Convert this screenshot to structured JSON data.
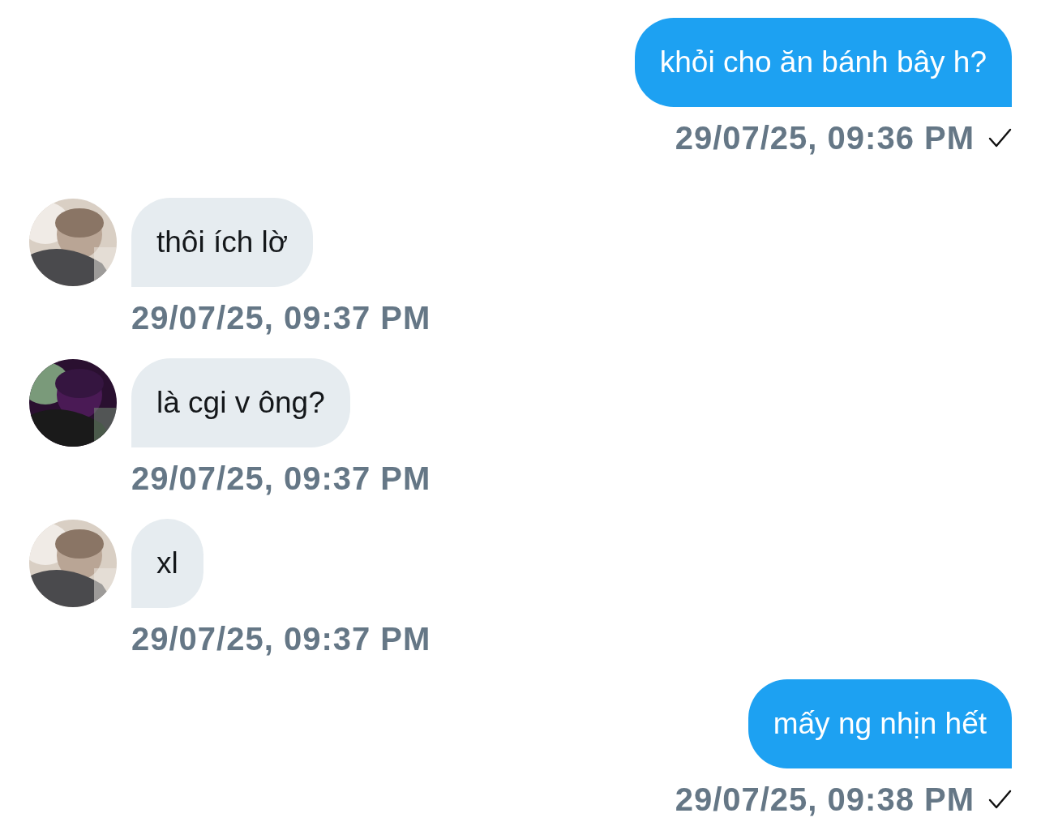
{
  "messages": [
    {
      "kind": "sent",
      "text": "khỏi cho ăn bánh bây h?",
      "time": "29/07/25, 09:36 PM",
      "delivered": true
    },
    {
      "kind": "received",
      "text": "thôi ích lờ",
      "time": "29/07/25, 09:37 PM"
    },
    {
      "kind": "received",
      "text": "là cgi v ông?",
      "time": "29/07/25, 09:37 PM"
    },
    {
      "kind": "received",
      "text": "xl",
      "time": "29/07/25, 09:37 PM"
    },
    {
      "kind": "sent",
      "text": "mấy ng nhịn hết",
      "time": "29/07/25, 09:38 PM",
      "delivered": true
    }
  ]
}
